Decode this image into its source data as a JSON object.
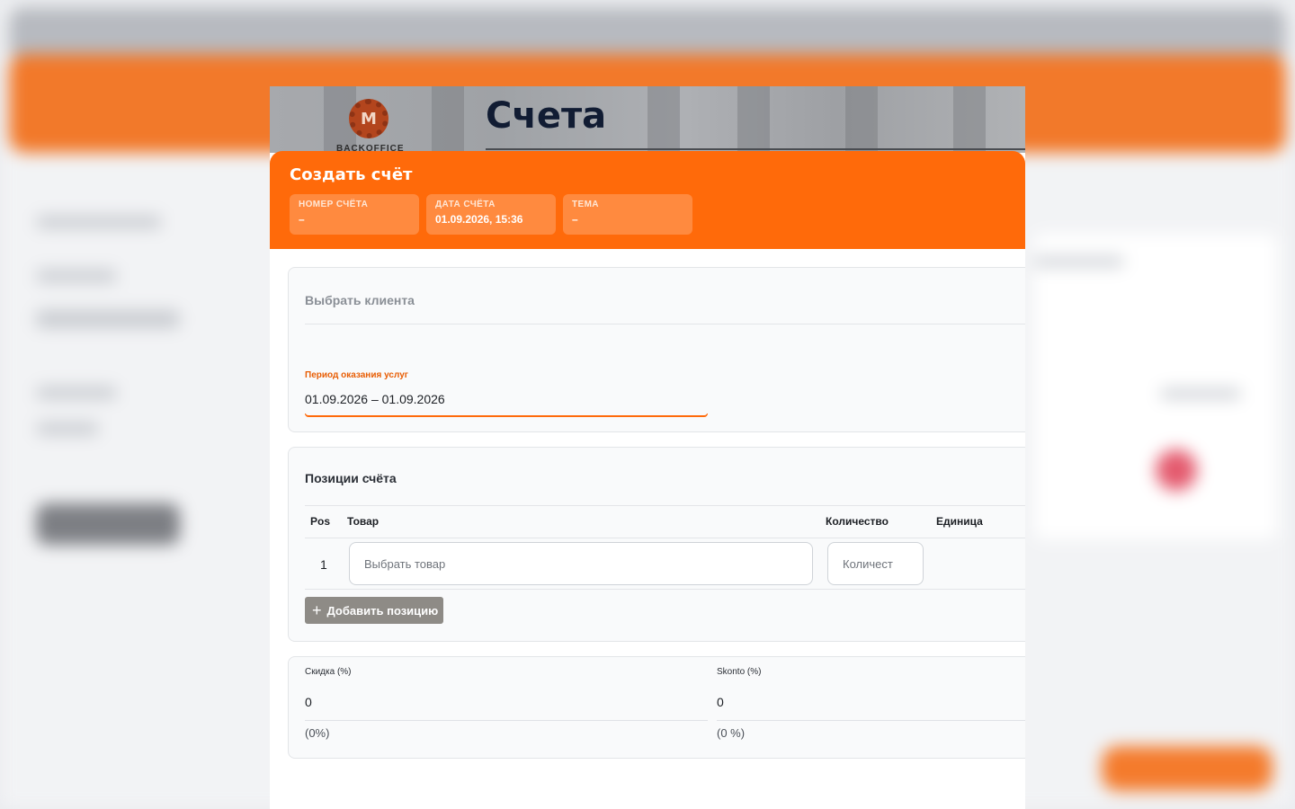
{
  "app": {
    "logo_text": "BACKOFFICE",
    "logo_letter": "M",
    "page_title": "Счета"
  },
  "modal": {
    "title": "Создать счёт",
    "info": [
      {
        "label": "НОМЕР СЧЁТА",
        "value": "–"
      },
      {
        "label": "ДАТА СЧЁТА",
        "value": "01.09.2026, 15:36"
      },
      {
        "label": "ТЕМА",
        "value": "–"
      }
    ]
  },
  "client": {
    "placeholder": "Выбрать клиента",
    "period_label": "Период оказания услуг",
    "period_value": "01.09.2026 – 01.09.2026"
  },
  "items": {
    "title": "Позиции счёта",
    "columns": [
      "Pos",
      "Товар",
      "Количество",
      "Единица"
    ],
    "rows": [
      {
        "pos": "1",
        "product_placeholder": "Выбрать товар",
        "qty_placeholder": "Количест"
      }
    ],
    "add_button": "Добавить позицию",
    "add_icon": "+"
  },
  "discounts": {
    "discount_label": "Скидка (%)",
    "discount_value": "0",
    "discount_note": "(0%)",
    "skonto_label": "Skonto (%)",
    "skonto_value": "0",
    "skonto_note": "(0 %)"
  },
  "colors": {
    "accent": "#ff6a0a",
    "button_gray": "#8e8b86",
    "title_navy": "#111c33"
  }
}
